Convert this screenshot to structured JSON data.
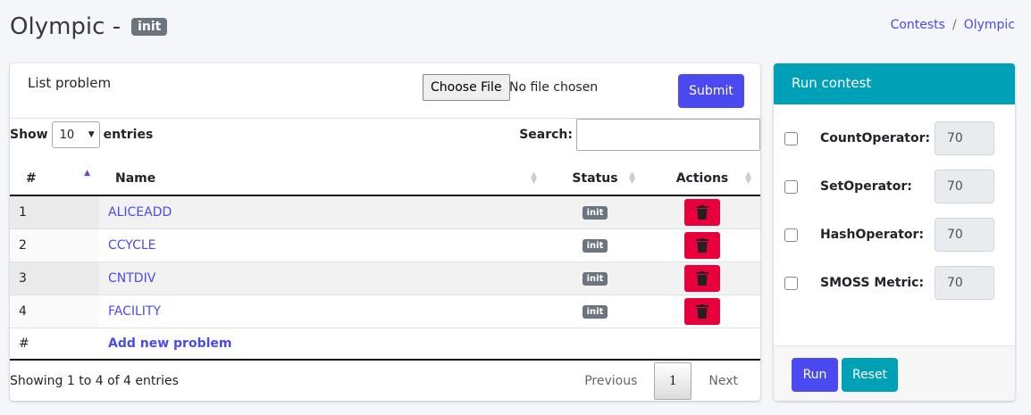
{
  "page": {
    "title": "Olympic -",
    "title_badge": "init",
    "breadcrumb": [
      "Contests",
      "/",
      "Olympic"
    ]
  },
  "list": {
    "title": "List problem",
    "choose_file_label": "Choose File",
    "file_status": "No file chosen",
    "submit_label": "Submit",
    "show_label": "Show",
    "entries_select": "10",
    "entries_label": "entries",
    "search_label": "Search:",
    "search_value": "",
    "columns": [
      "#",
      "Name",
      "Status",
      "Actions"
    ],
    "rows": [
      {
        "num": "1",
        "name": "ALICEADD",
        "status": "init"
      },
      {
        "num": "2",
        "name": "CCYCLE",
        "status": "init"
      },
      {
        "num": "3",
        "name": "CNTDIV",
        "status": "init"
      },
      {
        "num": "4",
        "name": "FACILITY",
        "status": "init"
      }
    ],
    "add_row_num": "#",
    "add_label": "Add new problem",
    "showing": "Showing 1 to 4 of 4 entries",
    "pager": {
      "previous": "Previous",
      "current": "1",
      "next": "Next"
    },
    "delete_icon": "trash-icon",
    "accent": "#4a4af0",
    "danger": "#e8003c"
  },
  "run": {
    "title": "Run contest",
    "items": [
      {
        "label": "CountOperator:",
        "value": "70"
      },
      {
        "label": "SetOperator:",
        "value": "70"
      },
      {
        "label": "HashOperator:",
        "value": "70"
      },
      {
        "label": "SMOSS Metric:",
        "value": "70"
      }
    ],
    "run_label": "Run",
    "reset_label": "Reset",
    "header_color": "#00a0b6"
  }
}
